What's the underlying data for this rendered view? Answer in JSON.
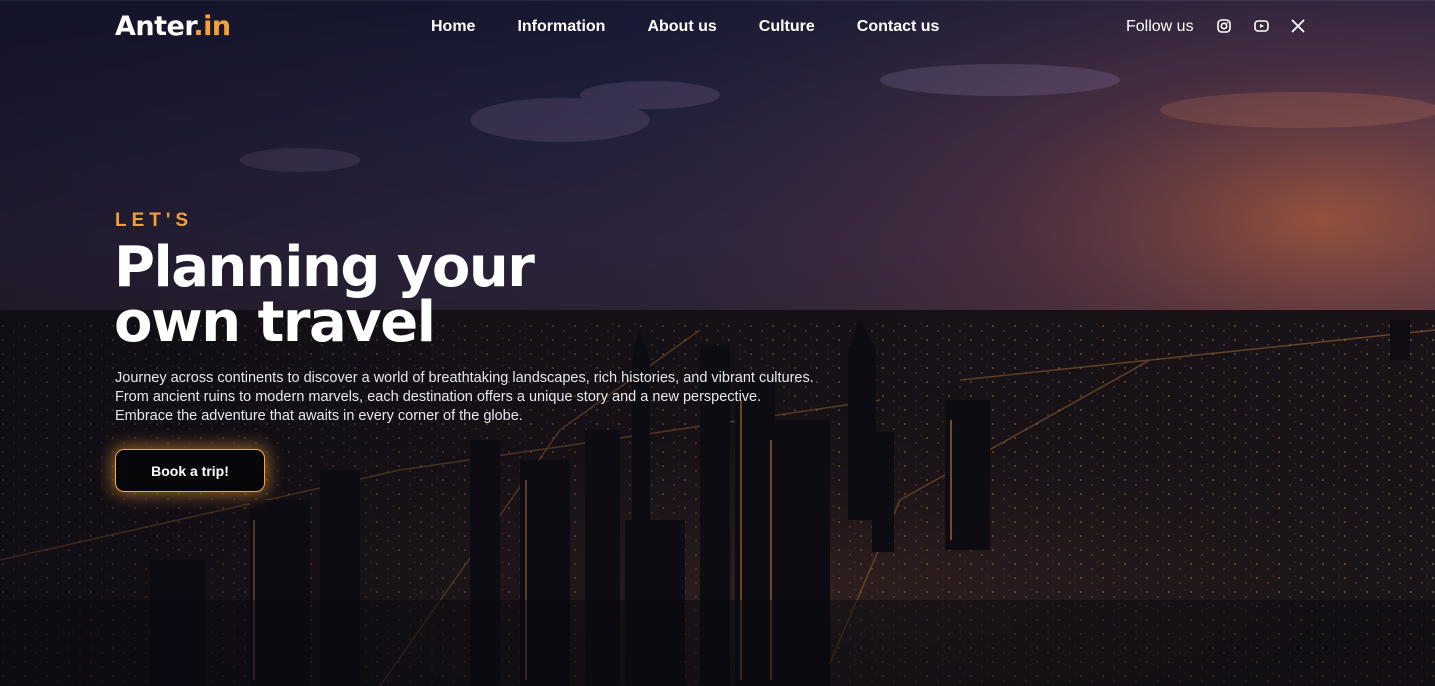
{
  "brand": {
    "name_main": "Anter",
    "name_suffix": ".in",
    "accent_color": "#f3a03a"
  },
  "nav": {
    "items": [
      {
        "label": "Home"
      },
      {
        "label": "Information"
      },
      {
        "label": "About us"
      },
      {
        "label": "Culture"
      },
      {
        "label": "Contact us"
      }
    ]
  },
  "social": {
    "label": "Follow us",
    "icons": [
      "instagram-icon",
      "youtube-icon",
      "x-icon"
    ]
  },
  "hero": {
    "eyebrow": "LET'S",
    "headline_line1": "Planning your",
    "headline_line2": "own travel",
    "description_lines": [
      "Journey across continents to discover a world of breathtaking landscapes, rich histories, and vibrant cultures.",
      "From ancient ruins to modern marvels, each destination offers a unique story and a new perspective.",
      "Embrace the adventure that awaits in every corner of the globe."
    ],
    "cta_label": "Book a trip!",
    "background": "aerial-city-night-skyline"
  }
}
